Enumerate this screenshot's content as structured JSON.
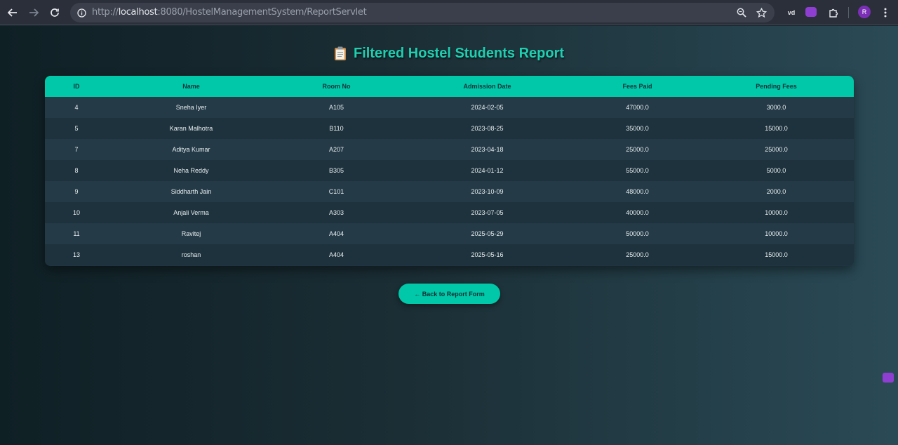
{
  "browser": {
    "url_prefix": "http://",
    "url_host": "localhost",
    "url_rest": ":8080/HostelManagementSystem/ReportServlet",
    "ext_vd_label": "vd",
    "profile_initial": "R"
  },
  "page": {
    "title_icon": "clipboard-icon",
    "title": "Filtered Hostel Students Report",
    "back_button": "← Back to Report Form"
  },
  "table": {
    "headers": [
      "ID",
      "Name",
      "Room No",
      "Admission Date",
      "Fees Paid",
      "Pending Fees"
    ],
    "rows": [
      [
        "4",
        "Sneha Iyer",
        "A105",
        "2024-02-05",
        "47000.0",
        "3000.0"
      ],
      [
        "5",
        "Karan Malhotra",
        "B110",
        "2023-08-25",
        "35000.0",
        "15000.0"
      ],
      [
        "7",
        "Aditya Kumar",
        "A207",
        "2023-04-18",
        "25000.0",
        "25000.0"
      ],
      [
        "8",
        "Neha Reddy",
        "B305",
        "2024-01-12",
        "55000.0",
        "5000.0"
      ],
      [
        "9",
        "Siddharth Jain",
        "C101",
        "2023-10-09",
        "48000.0",
        "2000.0"
      ],
      [
        "10",
        "Anjali Verma",
        "A303",
        "2023-07-05",
        "40000.0",
        "10000.0"
      ],
      [
        "11",
        "Ravitej",
        "A404",
        "2025-05-29",
        "50000.0",
        "10000.0"
      ],
      [
        "13",
        "roshan",
        "A404",
        "2025-05-16",
        "25000.0",
        "15000.0"
      ]
    ]
  },
  "colors": {
    "accent": "#00c8a8",
    "title": "#1ecfb0"
  }
}
